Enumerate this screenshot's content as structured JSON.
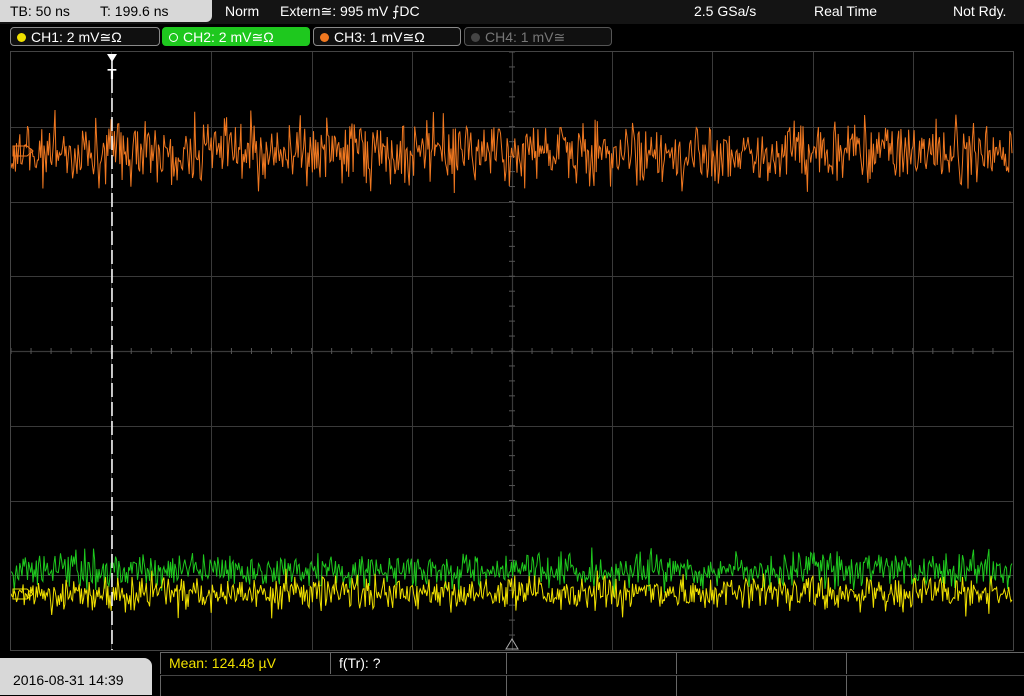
{
  "topbar": {
    "timebase": "TB: 50 ns",
    "trigger_pos": "T: 199.6 ns",
    "mode": "Norm",
    "trigger_source": "Extern≅: 995 mV ⨍DC",
    "sample_rate": "2.5 GSa/s",
    "acq_mode": "Real Time",
    "status": "Not Rdy."
  },
  "channels": [
    {
      "label": "CH1: 2 mV≅Ω",
      "color": "#f0e000"
    },
    {
      "label": "CH2: 2 mV≅Ω",
      "color": "#1ec81e"
    },
    {
      "label": "CH3: 1 mV≅Ω",
      "color": "#f07820"
    },
    {
      "label": "CH4: 1 mV≅",
      "color": "#666666"
    }
  ],
  "trigger_marker": "T",
  "bottombar": {
    "datetime": "2016-08-31 14:39",
    "measurement_1": "Mean: 124.48 µV",
    "measurement_2": "f(Tr): ?"
  },
  "colors": {
    "ch1": "#f0e000",
    "ch2": "#1ec81e",
    "ch3": "#f07820",
    "grid": "#3a3a3a",
    "measurement": "#f0e000"
  }
}
